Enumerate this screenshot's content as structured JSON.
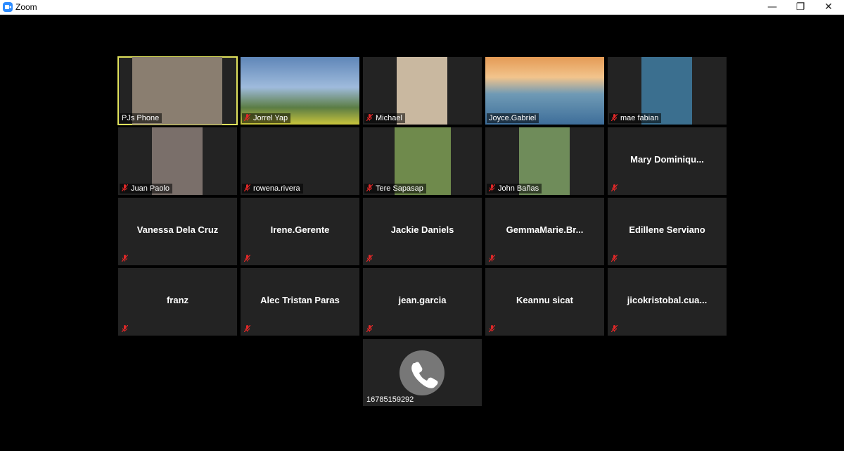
{
  "window": {
    "title": "Zoom",
    "controls": {
      "minimize": "—",
      "restore": "❐",
      "close": "✕"
    }
  },
  "colors": {
    "tile_bg": "#232323",
    "active_border": "#e0e25c",
    "mute_red": "#e02828"
  },
  "participants": [
    {
      "name": "PJs Phone",
      "video": true,
      "active": true,
      "muted": false
    },
    {
      "name": "Jorrel Yap",
      "video": true,
      "muted": true
    },
    {
      "name": "Michael",
      "video": true,
      "muted": true
    },
    {
      "name": "Joyce.Gabriel",
      "video": true,
      "muted": false
    },
    {
      "name": "mae fabian",
      "video": true,
      "muted": true
    },
    {
      "name": "Juan Paolo",
      "video": true,
      "muted": true
    },
    {
      "name": "rowena.rivera",
      "video": false,
      "muted": true,
      "show_label_only": true
    },
    {
      "name": "Tere Sapasap",
      "video": true,
      "muted": true
    },
    {
      "name": "John Bañas",
      "video": true,
      "muted": true
    },
    {
      "name": "Mary  Dominiqu...",
      "video": false,
      "muted": true
    },
    {
      "name": "Vanessa Dela Cruz",
      "video": false,
      "muted": true
    },
    {
      "name": "Irene.Gerente",
      "video": false,
      "muted": true
    },
    {
      "name": "Jackie Daniels",
      "video": false,
      "muted": true
    },
    {
      "name": "GemmaMarie.Br...",
      "video": false,
      "muted": true
    },
    {
      "name": "Edillene Serviano",
      "video": false,
      "muted": true
    },
    {
      "name": "franz",
      "video": false,
      "muted": true
    },
    {
      "name": "Alec Tristan Paras",
      "video": false,
      "muted": true
    },
    {
      "name": "jean.garcia",
      "video": false,
      "muted": true
    },
    {
      "name": "Keannu sicat",
      "video": false,
      "muted": true
    },
    {
      "name": "jicokristobal.cua...",
      "video": false,
      "muted": true
    }
  ],
  "phone_participant": {
    "number": "16785159292",
    "icon": "phone-icon"
  }
}
